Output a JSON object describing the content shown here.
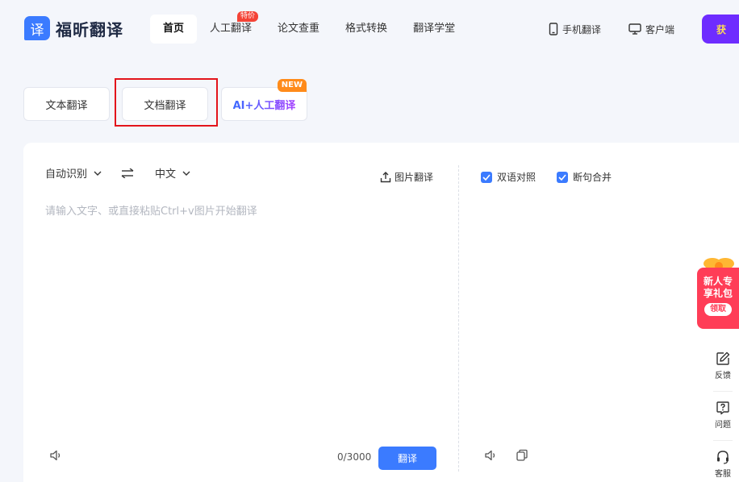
{
  "brand": {
    "logo_glyph": "译",
    "name": "福昕翻译",
    "color": "#3b7bff"
  },
  "nav": {
    "items": [
      {
        "label": "首页",
        "active": true
      },
      {
        "label": "人工翻译",
        "badge": "特价"
      },
      {
        "label": "论文查重"
      },
      {
        "label": "格式转换"
      },
      {
        "label": "翻译学堂"
      }
    ]
  },
  "header_right": {
    "mobile": "手机翻译",
    "desktop": "客户端",
    "get_button": "获"
  },
  "mode_tabs": {
    "text": "文本翻译",
    "document": "文档翻译",
    "ai": "AI+人工翻译",
    "ai_badge": "NEW"
  },
  "source": {
    "language": "自动识别",
    "target_language": "中文",
    "image_translate": "图片翻译",
    "placeholder": "请输入文字、或直接粘贴Ctrl+v图片开始翻译",
    "counter": "0/3000",
    "translate_button": "翻译"
  },
  "result": {
    "bilingual": "双语对照",
    "merge_sentences": "断句合并",
    "bilingual_checked": true,
    "merge_checked": true
  },
  "gift": {
    "line1": "新人专",
    "line2": "享礼包",
    "claim": "领取",
    "color": "#ff3d57"
  },
  "side_tools": {
    "feedback": "反馈",
    "question": "问题",
    "service": "客服"
  }
}
